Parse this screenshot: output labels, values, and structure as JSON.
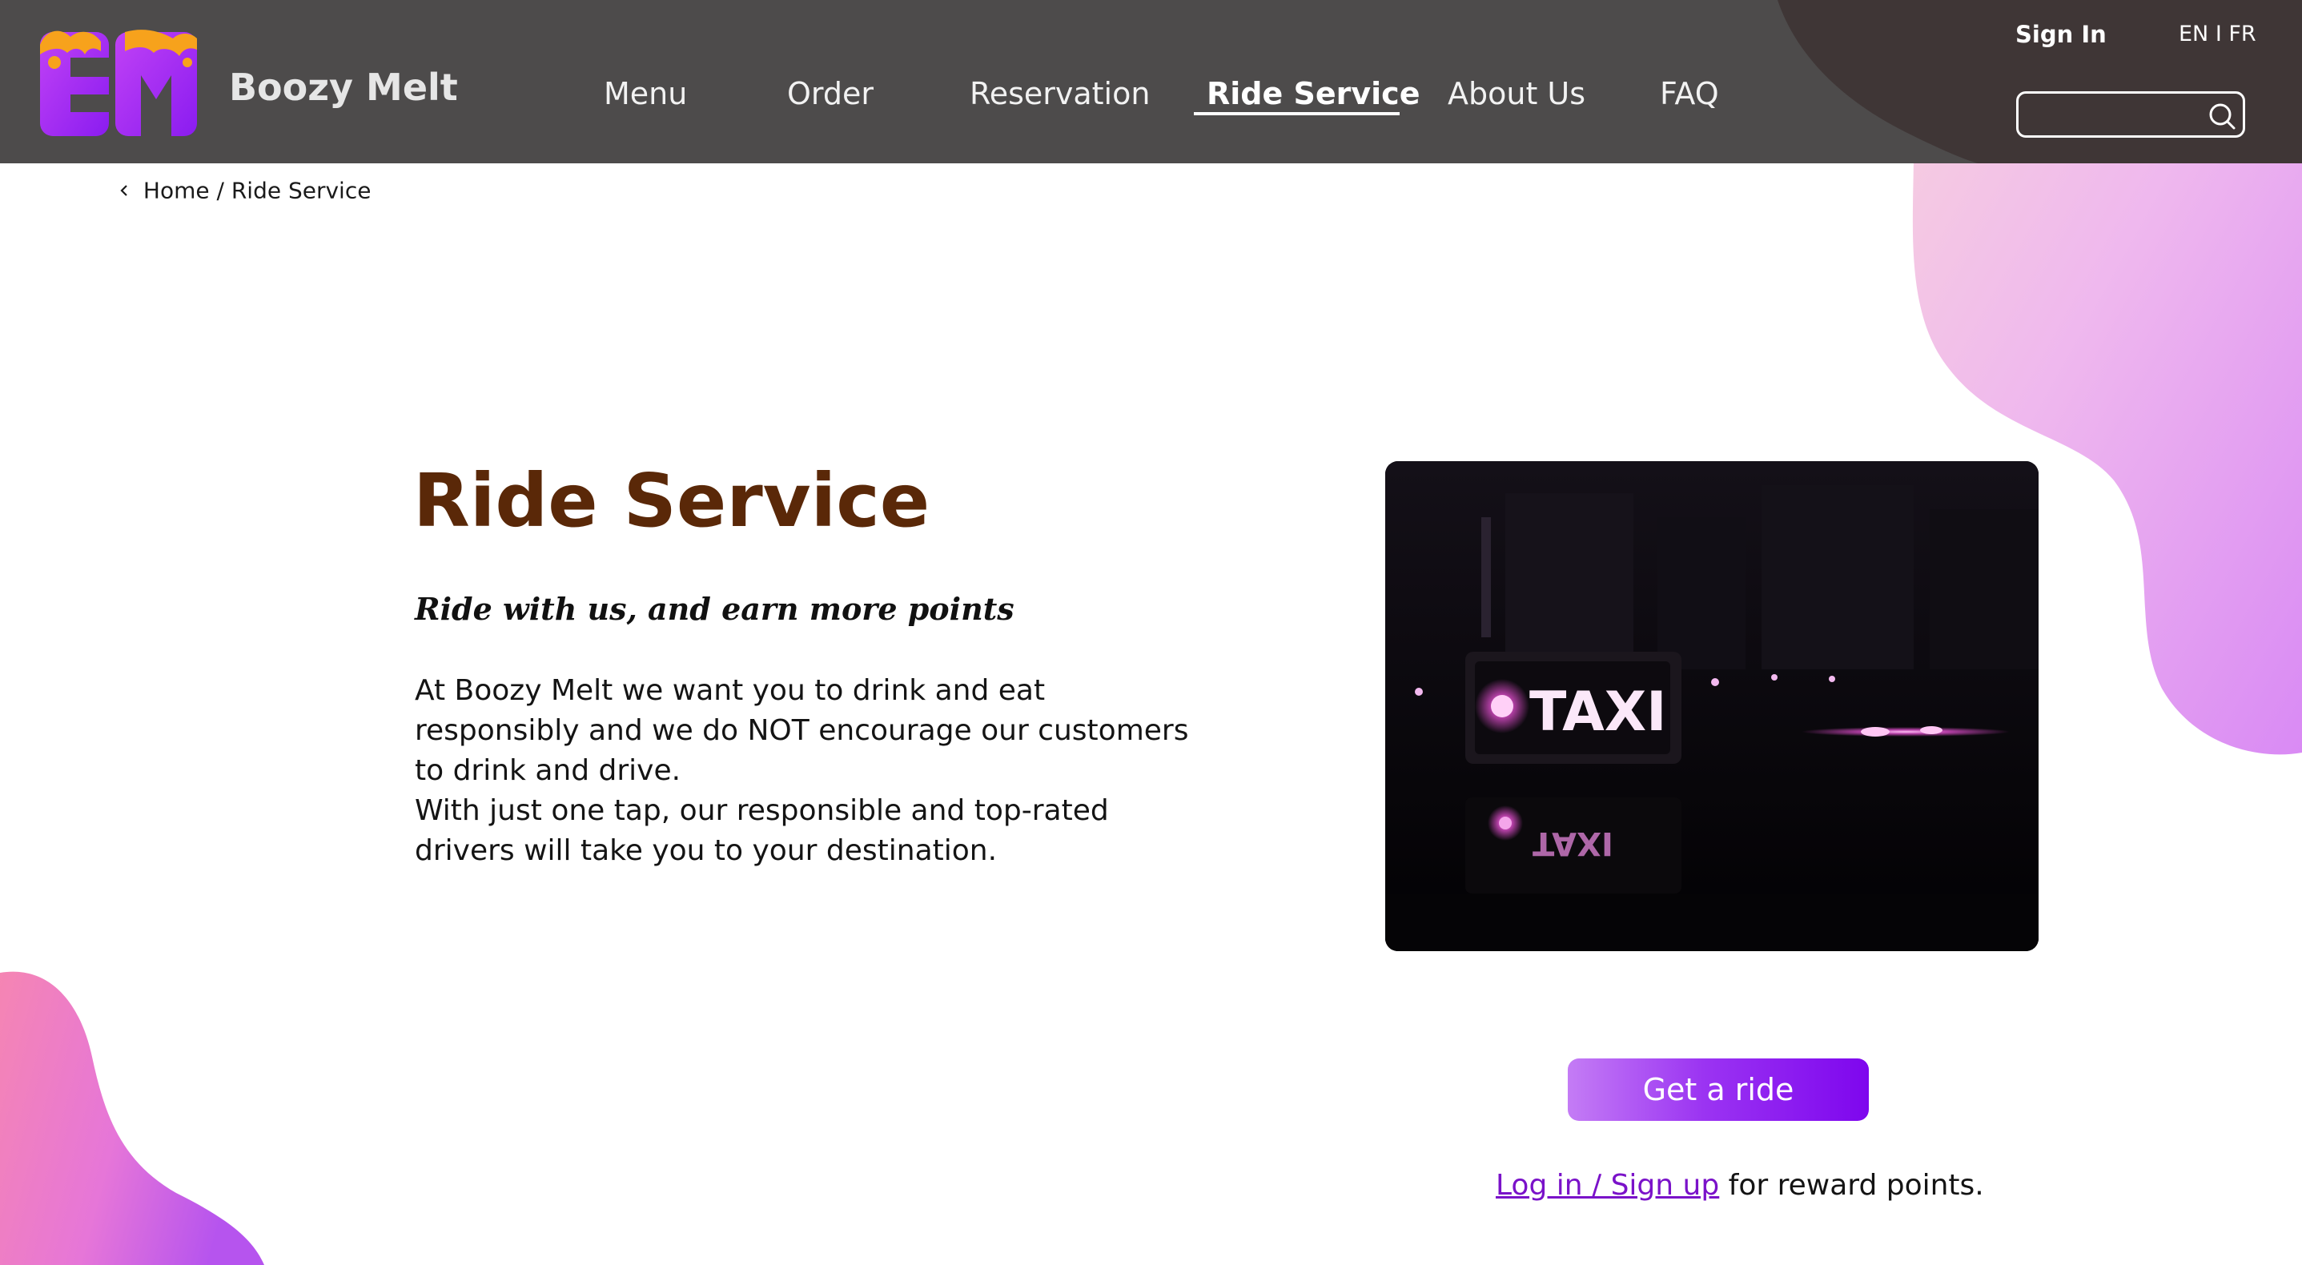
{
  "header": {
    "brand_name": "Boozy Melt",
    "nav": [
      {
        "label": "Menu"
      },
      {
        "label": "Order"
      },
      {
        "label": "Reservation"
      },
      {
        "label": "Ride Service",
        "active": true
      },
      {
        "label": "About Us"
      },
      {
        "label": "FAQ"
      }
    ],
    "sign_in": "Sign In",
    "language": "EN I FR",
    "search": {
      "value": "",
      "placeholder": ""
    }
  },
  "breadcrumb": {
    "home": "Home",
    "separator": "/",
    "current": "Ride Service"
  },
  "main": {
    "title": "Ride Service",
    "tagline": "Ride with us, and earn more points",
    "paragraphs": [
      "At Boozy Melt we want you to drink and eat responsibly and we do NOT encourage our customers to drink and drive.",
      "With just one tap, our responsible and top-rated drivers will take you to your destination."
    ],
    "image_sign_text": "TAXI",
    "cta_label": "Get a ride",
    "login_link": "Log in / Sign up",
    "reward_suffix": "for reward points."
  },
  "colors": {
    "header_bg": "#4d4b4b",
    "title": "#5a2808",
    "accent_purple": "#8b12f0",
    "link": "#7a12c9",
    "blob_pink": "#f78bb9",
    "blob_violet": "#c860f0"
  },
  "icons": [
    "brand-logo-icon",
    "back-chevron-icon",
    "search-icon"
  ]
}
